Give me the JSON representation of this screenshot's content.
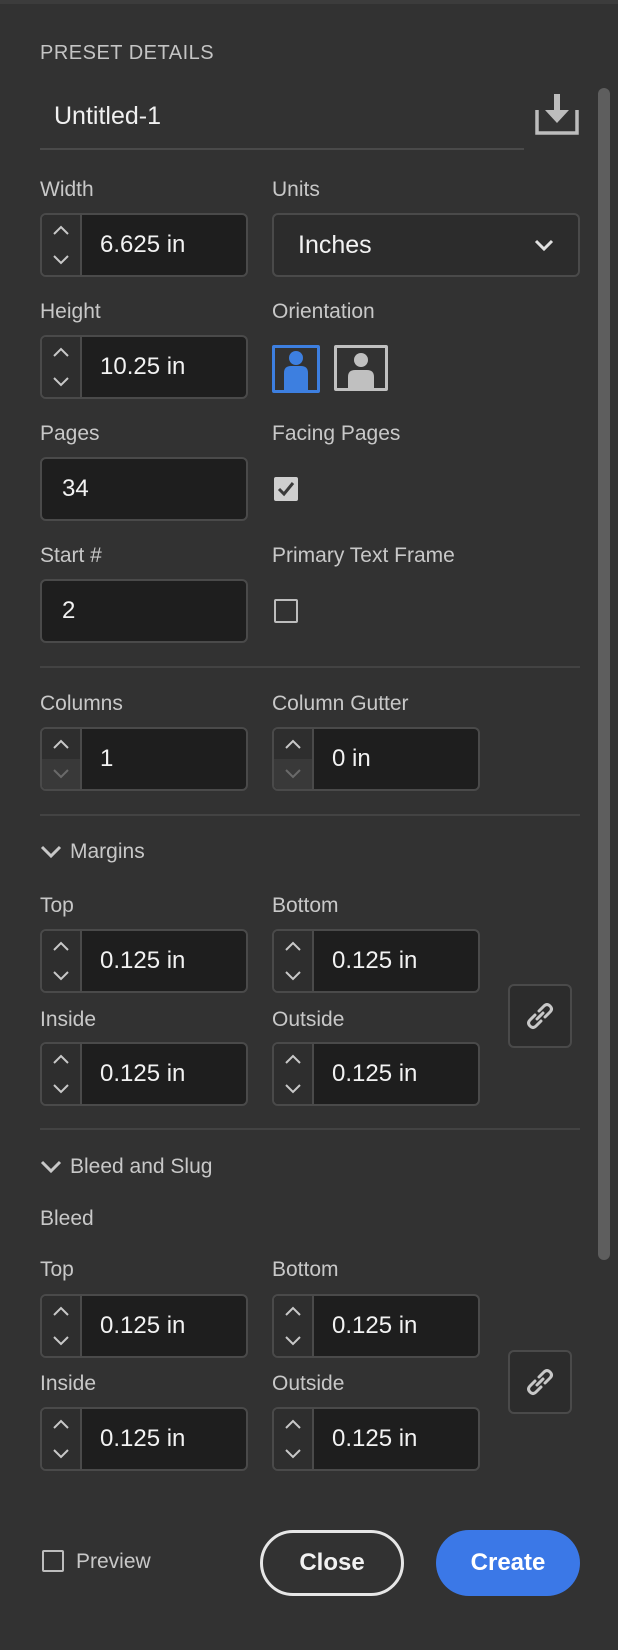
{
  "panel": {
    "section_title": "PRESET DETAILS",
    "document_name": "Untitled-1"
  },
  "width": {
    "label": "Width",
    "value": "6.625 in"
  },
  "units": {
    "label": "Units",
    "value": "Inches"
  },
  "height": {
    "label": "Height",
    "value": "10.25 in"
  },
  "orientation": {
    "label": "Orientation",
    "selected": "portrait"
  },
  "pages": {
    "label": "Pages",
    "value": "34"
  },
  "facing_pages": {
    "label": "Facing Pages",
    "checked": true
  },
  "start_number": {
    "label": "Start #",
    "value": "2"
  },
  "primary_text_frame": {
    "label": "Primary Text Frame",
    "checked": false
  },
  "columns": {
    "label": "Columns",
    "value": "1"
  },
  "column_gutter": {
    "label": "Column Gutter",
    "value": "0 in"
  },
  "margins": {
    "title": "Margins",
    "top_label": "Top",
    "top": "0.125 in",
    "bottom_label": "Bottom",
    "bottom": "0.125 in",
    "inside_label": "Inside",
    "inside": "0.125 in",
    "outside_label": "Outside",
    "outside": "0.125 in"
  },
  "bleed_slug": {
    "title": "Bleed and Slug",
    "bleed_label": "Bleed",
    "top_label": "Top",
    "top": "0.125 in",
    "bottom_label": "Bottom",
    "bottom": "0.125 in",
    "inside_label": "Inside",
    "inside": "0.125 in",
    "outside_label": "Outside",
    "outside": "0.125 in"
  },
  "footer": {
    "preview_label": "Preview",
    "preview_checked": false,
    "close_label": "Close",
    "create_label": "Create"
  },
  "colors": {
    "background": "#323232",
    "field": "#1e1e1e",
    "accent": "#3b78e7",
    "border": "#4a4a4a"
  }
}
